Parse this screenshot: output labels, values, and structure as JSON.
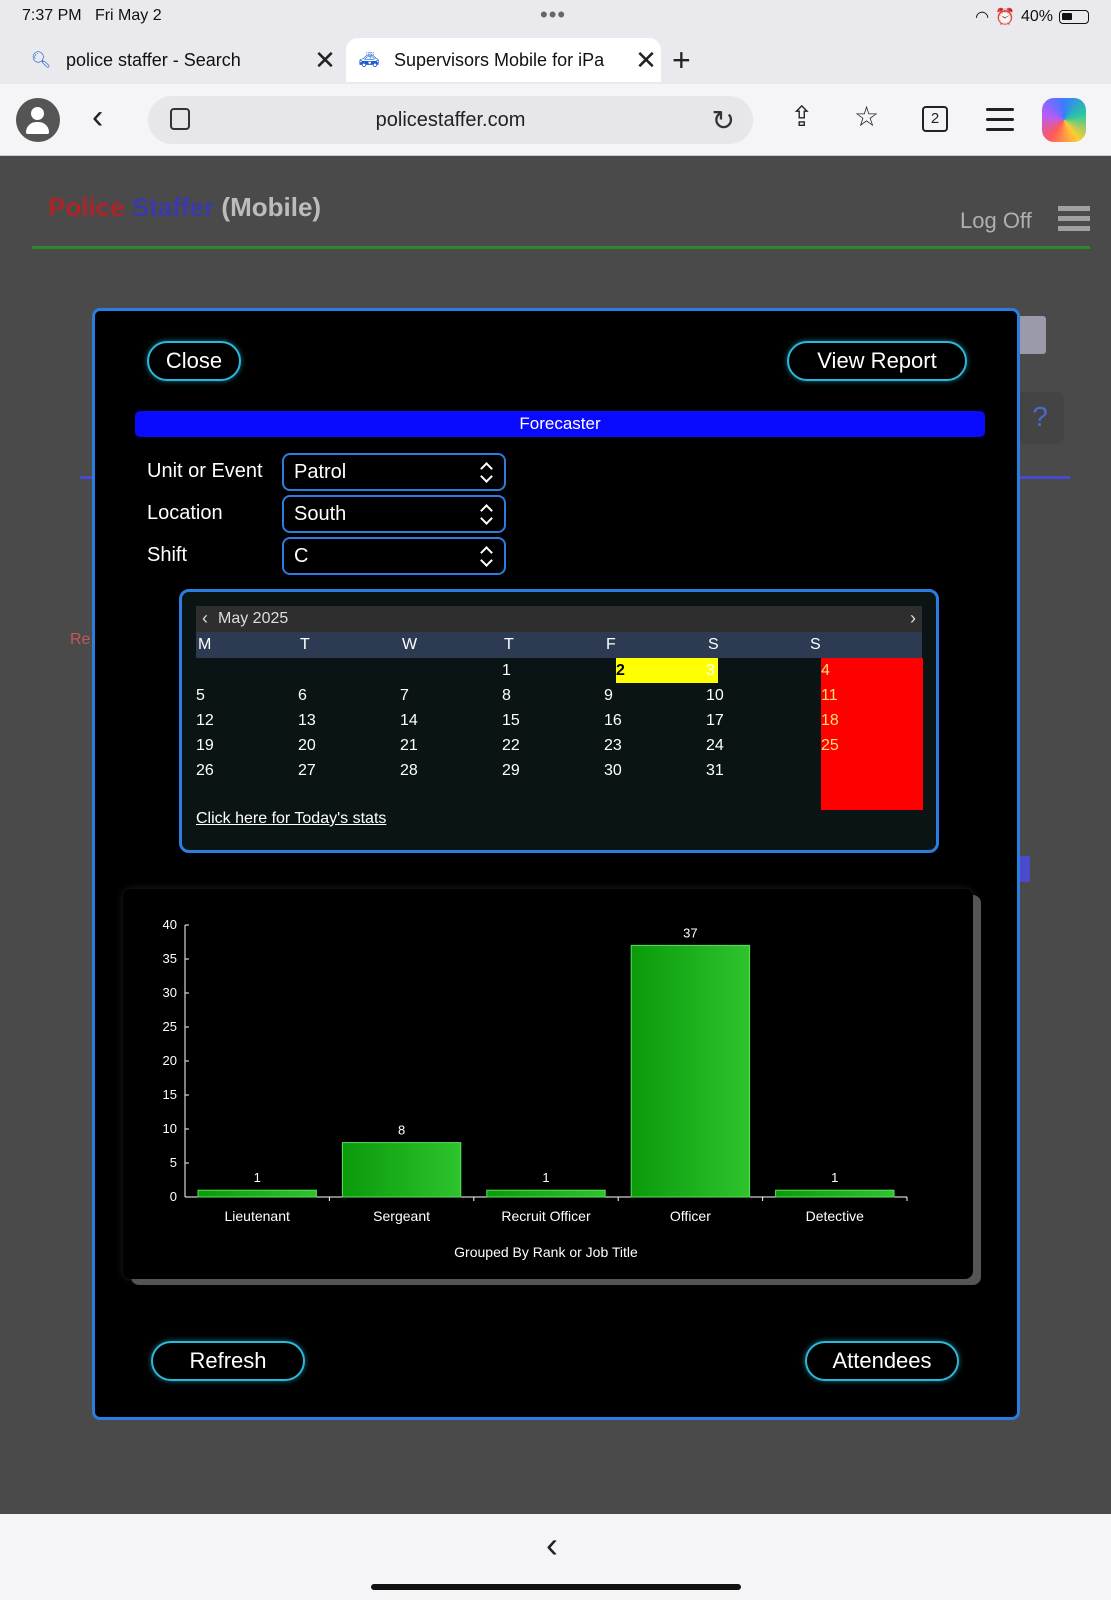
{
  "status_bar": {
    "time": "7:37 PM",
    "date": "Fri May 2",
    "battery": "40%"
  },
  "browser": {
    "tabs": [
      {
        "title": "police staffer - Search",
        "icon": "search-icon"
      },
      {
        "title": "Supervisors Mobile for iPa",
        "icon": "car-icon"
      }
    ],
    "url": "policestaffer.com",
    "tab_count": "2"
  },
  "page": {
    "brand_part1": "Police",
    "brand_part2": "Staffer",
    "brand_part3": "(Mobile)",
    "log_off": "Log Off",
    "ghost_text": "Re"
  },
  "modal": {
    "close_label": "Close",
    "view_report_label": "View Report",
    "forecaster_title": "Forecaster",
    "fields": [
      {
        "label": "Unit or Event",
        "value": "Patrol"
      },
      {
        "label": "Location",
        "value": "South"
      },
      {
        "label": "Shift",
        "value": "C"
      }
    ],
    "refresh_label": "Refresh",
    "attendees_label": "Attendees"
  },
  "calendar": {
    "month_title": "May 2025",
    "day_headers": [
      "M",
      "T",
      "W",
      "T",
      "F",
      "S",
      "S"
    ],
    "weeks": [
      [
        "",
        "",
        "",
        "1",
        "2",
        "3",
        "4"
      ],
      [
        "5",
        "6",
        "7",
        "8",
        "9",
        "10",
        "11"
      ],
      [
        "12",
        "13",
        "14",
        "15",
        "16",
        "17",
        "18"
      ],
      [
        "19",
        "20",
        "21",
        "22",
        "23",
        "24",
        "25"
      ],
      [
        "26",
        "27",
        "28",
        "29",
        "30",
        "31",
        ""
      ]
    ],
    "today": "2",
    "today_link": "Click here for Today's stats",
    "colors": {
      "today": "#ffff00",
      "sunday": "#ff0000"
    }
  },
  "chart_data": {
    "type": "bar",
    "categories": [
      "Lieutenant",
      "Sergeant",
      "Recruit Officer",
      "Officer",
      "Detective"
    ],
    "values": [
      1,
      8,
      1,
      37,
      1
    ],
    "title": "",
    "xlabel": "Grouped By Rank or Job Title",
    "ylabel": "",
    "ylim": [
      0,
      40
    ],
    "yticks": [
      0,
      5,
      10,
      15,
      20,
      25,
      30,
      35,
      40
    ],
    "bar_color": "#22bb22",
    "grid": false
  }
}
